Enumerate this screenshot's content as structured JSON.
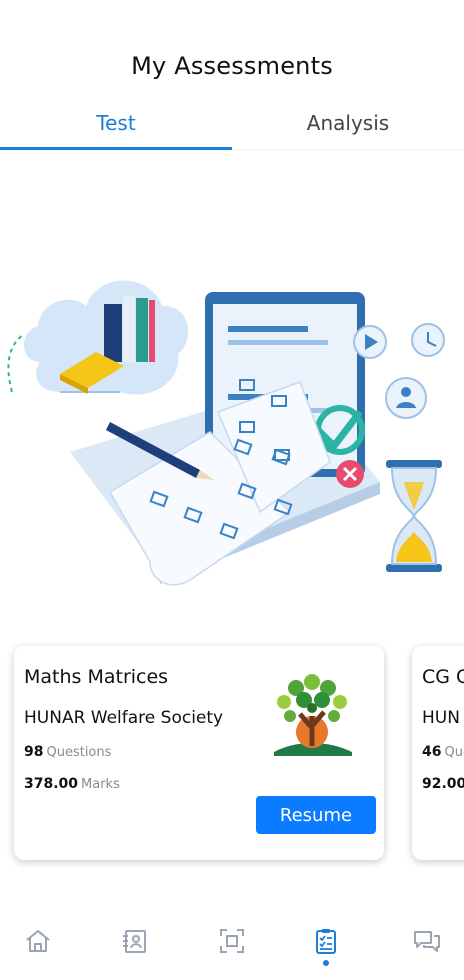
{
  "header": {
    "title": "My Assessments"
  },
  "tabs": [
    {
      "label": "Test",
      "active": true
    },
    {
      "label": "Analysis",
      "active": false
    }
  ],
  "cards": [
    {
      "title": "Maths Matrices",
      "organization": "HUNAR Welfare Society",
      "questions_count": "98",
      "questions_label": "Questions",
      "marks_value": "378.00",
      "marks_label": "Marks",
      "action_label": "Resume"
    },
    {
      "title": "CG G",
      "organization": "HUN",
      "questions_count": "46",
      "questions_label": "Que",
      "marks_value": "92.00",
      "marks_label": ""
    }
  ],
  "bottom_nav": [
    {
      "icon": "home-icon",
      "active": false
    },
    {
      "icon": "profile-card-icon",
      "active": false
    },
    {
      "icon": "scan-icon",
      "active": false
    },
    {
      "icon": "assessment-clipboard-icon",
      "active": true
    },
    {
      "icon": "chat-icon",
      "active": false
    }
  ],
  "colors": {
    "accent": "#1a7fd6",
    "button": "#0b7cff",
    "inactive_icon": "#9aa4b2"
  }
}
